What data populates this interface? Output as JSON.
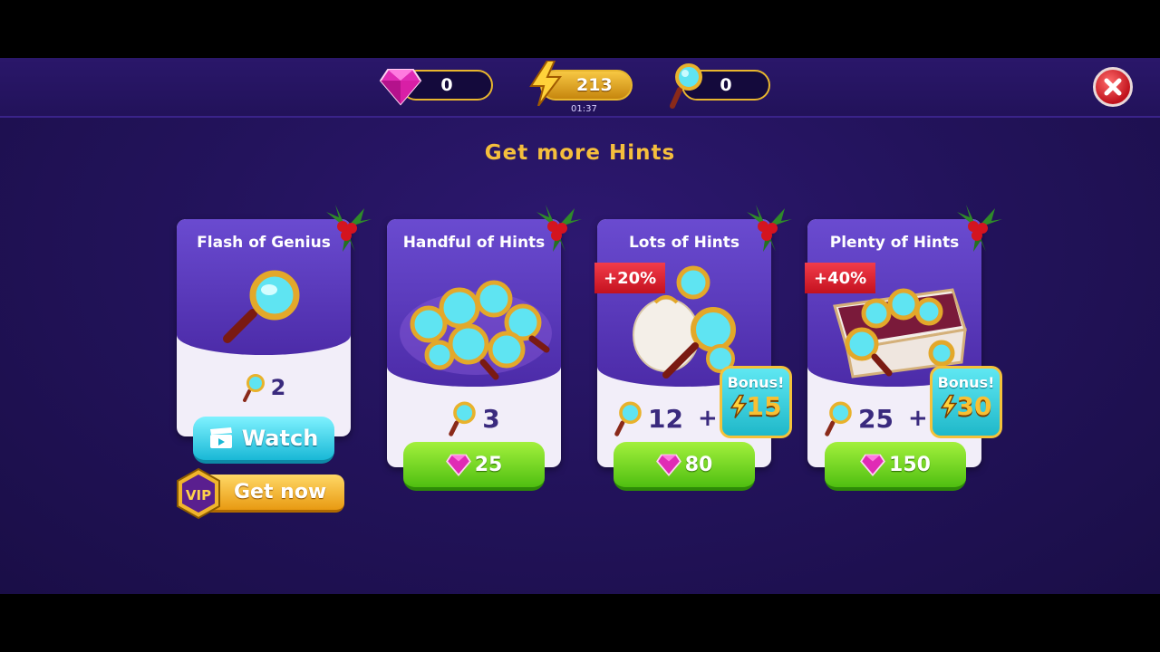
{
  "currency": {
    "gems": "0",
    "energy": "213",
    "energy_timer": "01:37",
    "hints": "0"
  },
  "title": "Get more Hints",
  "cards": [
    {
      "name": "Flash of Genius",
      "hints": "2",
      "action": "Watch"
    },
    {
      "name": "Handful of Hints",
      "hints": "3",
      "price": "25"
    },
    {
      "name": "Lots of Hints",
      "hints": "12",
      "plus": "+",
      "ribbon": "+20%",
      "bonus_label": "Bonus!",
      "bonus_value": "15",
      "price": "80"
    },
    {
      "name": "Plenty of Hints",
      "hints": "25",
      "plus": "+",
      "ribbon": "+40%",
      "bonus_label": "Bonus!",
      "bonus_value": "30",
      "price": "150"
    }
  ],
  "vip": {
    "badge": "VIP",
    "label": "Get now"
  },
  "colors": {
    "accent_gold": "#f5bf3c",
    "buy_green": "#4fbf11",
    "watch_cyan": "#19b8d6",
    "ribbon_red": "#e02a38",
    "bg_purple": "#23135c"
  }
}
